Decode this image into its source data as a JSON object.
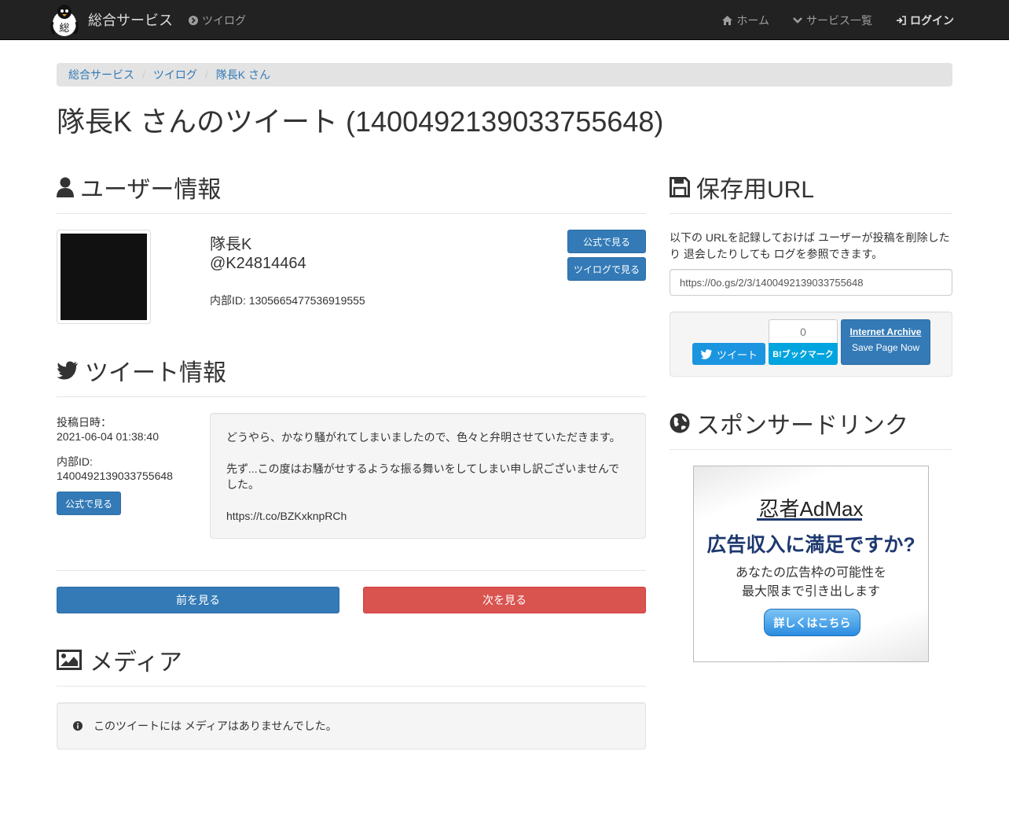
{
  "navbar": {
    "brand": "総合サービス",
    "twilog": "ツイログ",
    "home": "ホーム",
    "services": "サービス一覧",
    "login": "ログイン"
  },
  "breadcrumb": [
    "総合サービス",
    "ツイログ",
    "隊長K さん"
  ],
  "page_title": "隊長K さんのツイート (1400492139033755648)",
  "user_section": {
    "heading": "ユーザー情報",
    "name": "隊長K",
    "handle": "@K24814464",
    "internal_id": "内部ID: 1305665477536919555",
    "btn_official": "公式で見る",
    "btn_twilog": "ツイログで見る"
  },
  "tweet_section": {
    "heading": "ツイート情報",
    "posted_label": "投稿日時：",
    "posted_value": "2021-06-04 01:38:40",
    "id_label": "内部ID:",
    "id_value": "1400492139033755648",
    "btn_official": "公式で見る",
    "body": [
      "どうやら、かなり騒がれてしまいましたので、色々と弁明させていただきます。",
      "先ず...この度はお騒がせするような振る舞いをしてしまい申し訳ございませんでした。",
      "https://t.co/BZKxknpRCh"
    ]
  },
  "pager": {
    "prev": "前を見る",
    "next": "次を見る"
  },
  "media_section": {
    "heading": "メディア",
    "empty": "このツイートには メディアはありませんでした。"
  },
  "save_section": {
    "heading": "保存用URL",
    "description": "以下の URLを記録しておけば ユーザーが投稿を削除したり 退会したりしても ログを参照できます。",
    "url": "https://0o.gs/2/3/1400492139033755648",
    "tweet_btn": "ツイート",
    "hatena_count": "0",
    "hatena_btn": "B!ブックマーク",
    "ia_title": "Internet Archive",
    "ia_sub": "Save Page Now"
  },
  "sponsor_section": {
    "heading": "スポンサードリンク",
    "ad_logo": "忍者AdMax",
    "ad_headline": "広告収入に満足ですか?",
    "ad_line1": "あなたの広告枠の可能性を",
    "ad_line2": "最大限まで引き出します",
    "ad_button": "詳しくはこちら"
  },
  "colors": {
    "navbar_bg": "#222222",
    "primary": "#337ab7",
    "danger": "#d9534f",
    "twitter": "#1b95e0",
    "hatena": "#00a4de"
  }
}
